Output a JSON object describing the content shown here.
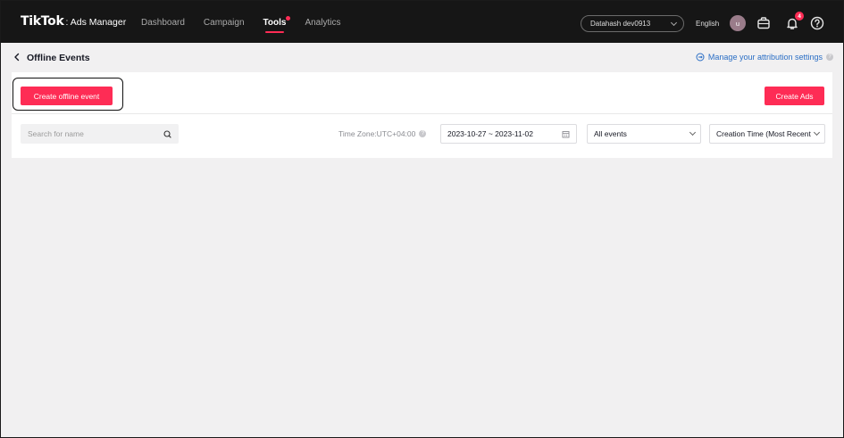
{
  "topbar": {
    "brand": "TikTok",
    "product": ": Ads Manager",
    "nav": [
      {
        "label": "Dashboard"
      },
      {
        "label": "Campaign"
      },
      {
        "label": "Tools"
      },
      {
        "label": "Analytics"
      }
    ],
    "account": "Datahash dev0913",
    "language": "English",
    "avatar_initial": "u",
    "notification_count": "4"
  },
  "page": {
    "title": "Offline Events",
    "attribution_link": "Manage your attribution settings"
  },
  "actions": {
    "create_offline_event": "Create offline event",
    "create_ads": "Create Ads"
  },
  "filters": {
    "search_placeholder": "Search for name",
    "timezone": "Time Zone:UTC+04:00",
    "date_range": "2023-10-27 ~ 2023-11-02",
    "events_select": "All events",
    "sort_select": "Creation Time (Most Recent)"
  },
  "colors": {
    "accent": "#fe2c55",
    "link": "#2a6ec5",
    "topbar": "#161616"
  }
}
